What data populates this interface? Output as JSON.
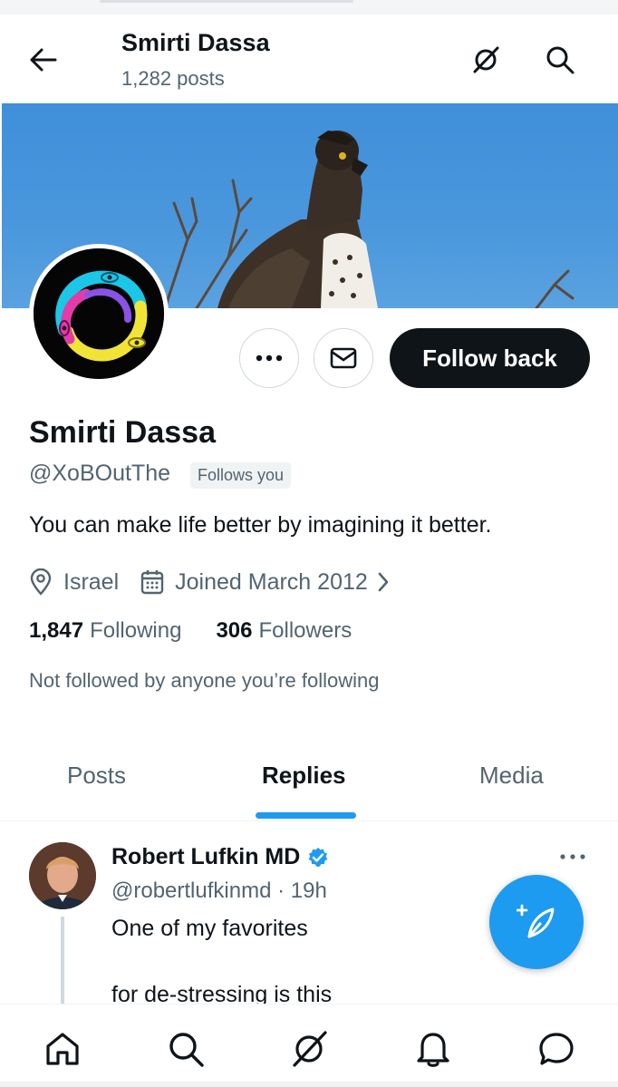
{
  "header": {
    "title": "Smirti Dassa",
    "post_count": "1,282 posts"
  },
  "profile": {
    "name": "Smirti Dassa",
    "handle": "@XoBOutThe",
    "follows_you_badge": "Follows you",
    "bio": "You can make life better by imagining it better.",
    "location": "Israel",
    "joined": "Joined March 2012",
    "following_count": "1,847",
    "following_label": "Following",
    "followers_count": "306",
    "followers_label": "Followers",
    "not_followed_text": "Not followed by anyone you’re following",
    "follow_button_label": "Follow back"
  },
  "tabs": [
    {
      "label": "Posts",
      "active": false
    },
    {
      "label": "Replies",
      "active": true
    },
    {
      "label": "Media",
      "active": false
    }
  ],
  "post": {
    "author_name": "Robert Lufkin MD",
    "author_handle": "@robertlufkinmd · 19h",
    "text_line1": "One of my favorites",
    "text_line2": "for de-stressing is this",
    "verified": true
  },
  "colors": {
    "accent": "#1d9bf0",
    "text_primary": "#0f1419",
    "text_secondary": "#536471",
    "button_dark": "#0f1419"
  },
  "icons": {
    "back": "arrow-left-icon",
    "grok": "grok-icon",
    "search": "search-icon",
    "more": "more-icon",
    "mail": "mail-icon",
    "location": "location-pin-icon",
    "calendar": "calendar-icon",
    "compose": "compose-icon",
    "home": "home-icon",
    "notifications": "bell-icon",
    "messages": "chat-icon"
  }
}
